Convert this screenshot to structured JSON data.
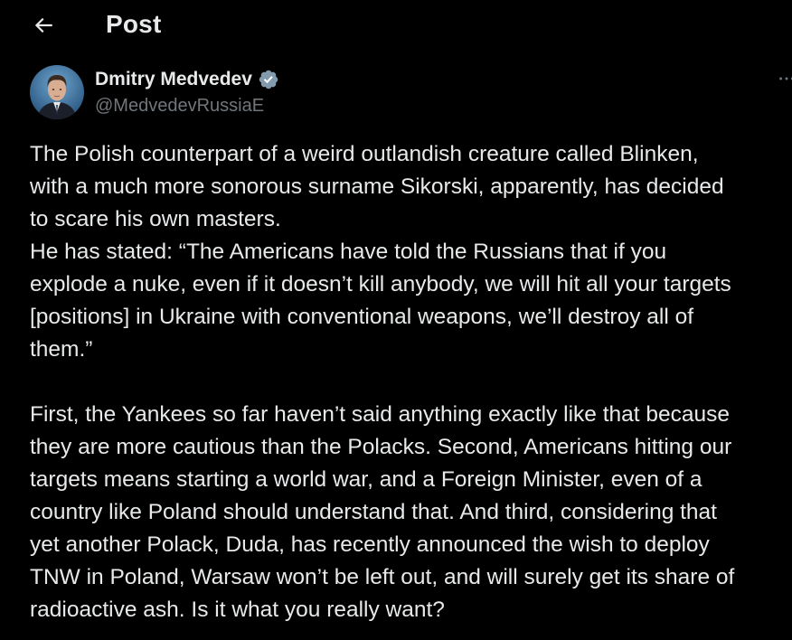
{
  "header": {
    "title": "Post"
  },
  "author": {
    "name": "Dmitry Medvedev",
    "handle": "@MedvedevRussiaE",
    "verified": true
  },
  "post": {
    "paragraph1_lines": [
      "The Polish counterpart of a weird outlandish creature called Blinken,",
      "with a much more sonorous surname Sikorski, apparently, has decided",
      "to scare his own masters.",
      "He has stated: “The Americans have told the Russians that if you",
      "explode a nuke, even if it doesn’t kill anybody, we will hit all your targets",
      "[positions] in Ukraine with conventional weapons, we’ll destroy all of",
      "them.”"
    ],
    "paragraph2_lines": [
      "First, the Yankees so far haven’t said anything exactly like that because",
      "they are more cautious than the Polacks. Second, Americans hitting our",
      "targets means starting a world war, and a Foreign Minister, even of a",
      "country like Poland should understand that. And third, considering that",
      "yet another Polack, Duda, has recently announced the wish to deploy",
      "TNW in Poland, Warsaw won’t be left out, and will surely get its share of",
      "radioactive ash. Is it what you really want?"
    ]
  },
  "icons": {
    "back": "back-arrow-icon",
    "verified": "verified-badge-icon",
    "more": "more-options-icon"
  },
  "colors": {
    "background": "#000000",
    "text": "#e7e9ea",
    "secondary_text": "#71767b",
    "verified_badge": "#829aab"
  }
}
